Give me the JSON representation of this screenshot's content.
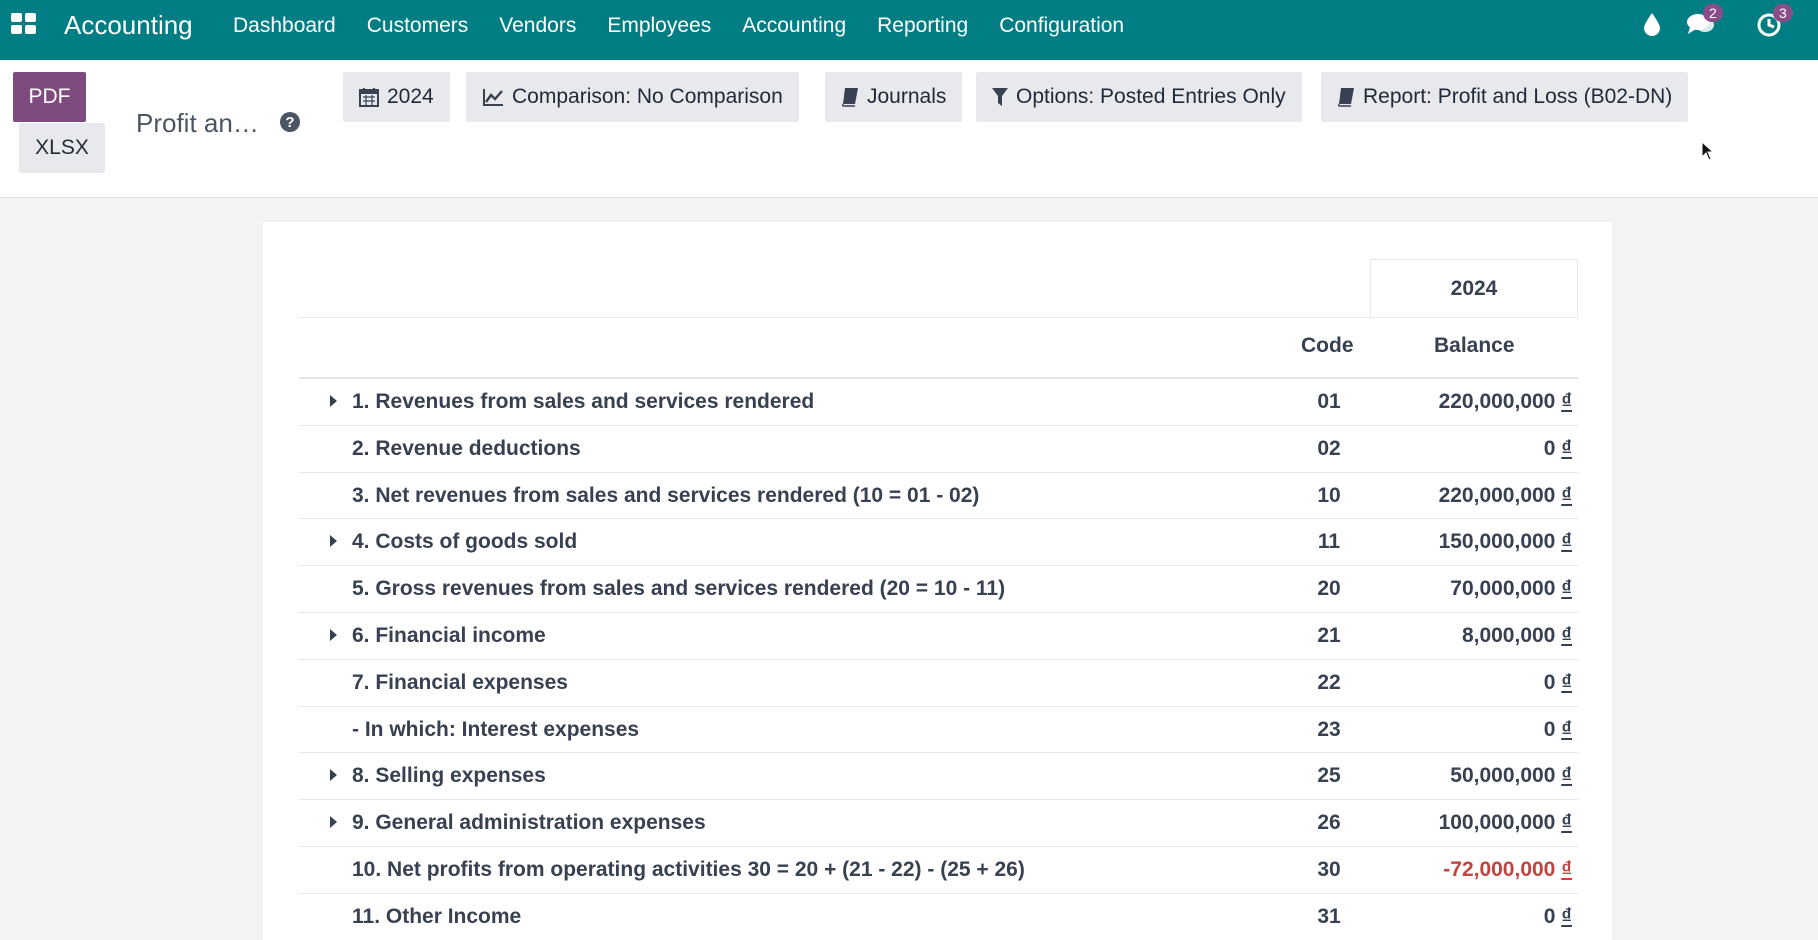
{
  "navbar": {
    "app_title": "Accounting",
    "menu": [
      "Dashboard",
      "Customers",
      "Vendors",
      "Employees",
      "Accounting",
      "Reporting",
      "Configuration"
    ],
    "chat_badge": "2",
    "activity_badge": "3",
    "bg_color": "#017e84"
  },
  "control_panel": {
    "pdf_label": "PDF",
    "xlsx_label": "XLSX",
    "report_title": "Profit an…",
    "filters": {
      "date": "2024",
      "comparison": "Comparison: No Comparison",
      "journals": "Journals",
      "options": "Options: Posted Entries Only",
      "report": "Report: Profit and Loss (B02-DN)"
    }
  },
  "report": {
    "period_header": "2024",
    "code_header": "Code",
    "balance_header": "Balance",
    "rows": [
      {
        "name": "1. Revenues from sales and services rendered",
        "code": "01",
        "balance": "220,000,000",
        "expandable": true,
        "negative": false
      },
      {
        "name": "2. Revenue deductions",
        "code": "02",
        "balance": "0",
        "expandable": false,
        "negative": false
      },
      {
        "name": "3. Net revenues from sales and services rendered (10 = 01 - 02)",
        "code": "10",
        "balance": "220,000,000",
        "expandable": false,
        "negative": false
      },
      {
        "name": "4. Costs of goods sold",
        "code": "11",
        "balance": "150,000,000",
        "expandable": true,
        "negative": false
      },
      {
        "name": "5. Gross revenues from sales and services rendered (20 = 10 - 11)",
        "code": "20",
        "balance": "70,000,000",
        "expandable": false,
        "negative": false
      },
      {
        "name": "6. Financial income",
        "code": "21",
        "balance": "8,000,000",
        "expandable": true,
        "negative": false
      },
      {
        "name": "7. Financial expenses",
        "code": "22",
        "balance": "0",
        "expandable": false,
        "negative": false
      },
      {
        "name": "- In which: Interest expenses",
        "code": "23",
        "balance": "0",
        "expandable": false,
        "negative": false
      },
      {
        "name": "8. Selling expenses",
        "code": "25",
        "balance": "50,000,000",
        "expandable": true,
        "negative": false
      },
      {
        "name": "9. General administration expenses",
        "code": "26",
        "balance": "100,000,000",
        "expandable": true,
        "negative": false
      },
      {
        "name": "10. Net profits from operating activities 30 = 20 + (21 - 22) - (25 + 26)",
        "code": "30",
        "balance": "-72,000,000",
        "expandable": false,
        "negative": true
      },
      {
        "name": "11. Other Income",
        "code": "31",
        "balance": "0",
        "expandable": false,
        "negative": false
      }
    ],
    "currency_symbol": "₫",
    "negative_color": "#c2443f"
  }
}
